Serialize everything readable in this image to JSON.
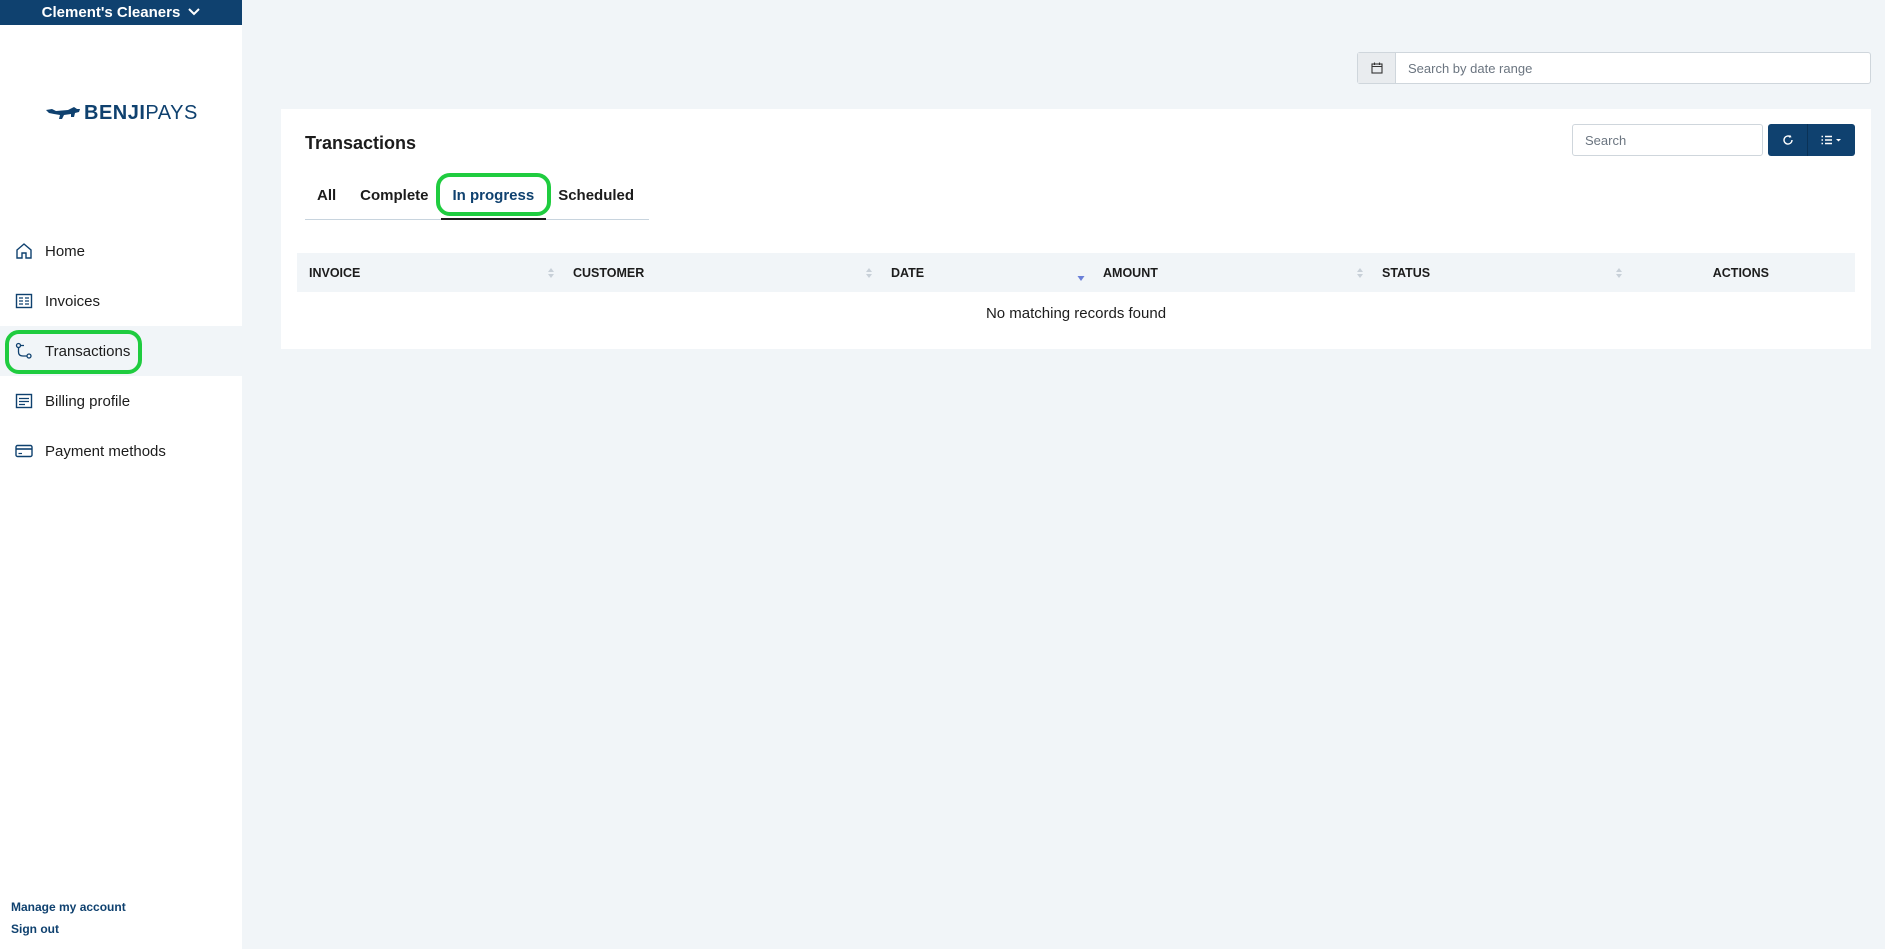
{
  "org_switcher": {
    "name": "Clement's Cleaners"
  },
  "logo": {
    "brand_bold": "BENJI",
    "brand_light": "PAYS"
  },
  "sidebar": {
    "items": [
      {
        "label": "Home",
        "icon": "home-icon"
      },
      {
        "label": "Invoices",
        "icon": "invoice-icon"
      },
      {
        "label": "Transactions",
        "icon": "transactions-icon",
        "active": true
      },
      {
        "label": "Billing profile",
        "icon": "billing-profile-icon"
      },
      {
        "label": "Payment methods",
        "icon": "credit-card-icon"
      }
    ],
    "footer": {
      "manage_account": "Manage my account",
      "sign_out": "Sign out"
    }
  },
  "date_range": {
    "placeholder": "Search by date range",
    "icon": "calendar-icon"
  },
  "card": {
    "title": "Transactions",
    "tabs": [
      {
        "label": "All"
      },
      {
        "label": "Complete"
      },
      {
        "label": "In progress",
        "active": true
      },
      {
        "label": "Scheduled"
      }
    ],
    "search": {
      "placeholder": "Search"
    },
    "buttons": {
      "refresh_icon": "refresh-icon",
      "columns_icon": "column-list-icon"
    }
  },
  "table": {
    "columns": [
      "INVOICE",
      "CUSTOMER",
      "DATE",
      "AMOUNT",
      "STATUS",
      "ACTIONS"
    ],
    "sorted_column": "DATE",
    "sort_direction": "desc",
    "empty_message": "No matching records found"
  },
  "colors": {
    "brand": "#0f416f",
    "highlight": "#1fcc3f",
    "background": "#f1f5f8"
  }
}
